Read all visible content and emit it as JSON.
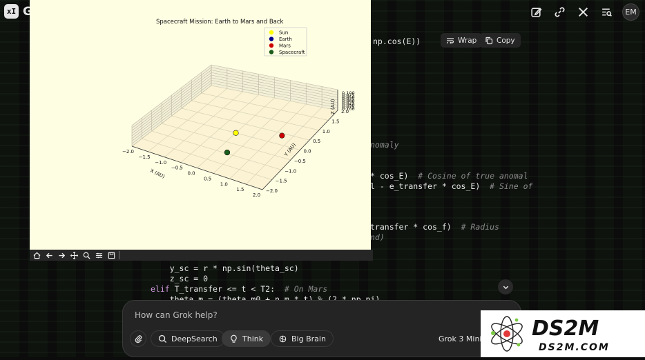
{
  "app": {
    "logo_glyph": "xI",
    "title_fragment": "G"
  },
  "header": {
    "icons": [
      "edit-icon",
      "link-icon",
      "x-logo-icon",
      "search-list-icon"
    ],
    "avatar_initials": "EM"
  },
  "code_block": {
    "wrap_label": "Wrap",
    "copy_label": "Copy",
    "lines": [
      {
        "text": "np.cos(E))",
        "comment": ""
      },
      {
        "text": "",
        "comment": "nomaly"
      },
      {
        "text": "* cos_E)",
        "comment": "# Cosine of true anomal"
      },
      {
        "text": "l - e_transfer * cos_E)",
        "comment": "# Sine of"
      },
      {
        "text": "transfer * cos_f)",
        "comment": "# Radius"
      },
      {
        "text": "",
        "comment": "nd)"
      },
      {
        "text": "    y_sc = r * np.sin(theta_sc)",
        "comment": ""
      },
      {
        "text": "    z_sc = 0",
        "comment": ""
      },
      {
        "keyword": "elif",
        "text": " T_transfer <= t < T2:",
        "comment": "# On Mars"
      },
      {
        "text": "    theta_m = (theta_m0 + n_m * t) % (2 * np.pi)",
        "comment": ""
      }
    ]
  },
  "plot_window": {
    "toolbar_icons": [
      "home-icon",
      "back-arrow-icon",
      "forward-arrow-icon",
      "pan-icon",
      "zoom-icon",
      "configure-icon",
      "save-icon"
    ]
  },
  "chart_data": {
    "type": "scatter",
    "projection": "3d",
    "title": "Spacecraft Mission: Earth to Mars and Back",
    "xlabel": "X (AU)",
    "ylabel": "Y (AU)",
    "zlabel": "Z (AU)",
    "x_ticks": [
      "−2.0",
      "−1.5",
      "−1.0",
      "−0.5",
      "0.0",
      "0.5",
      "1.0",
      "1.5",
      "2.0"
    ],
    "y_ticks": [
      "−2.0",
      "−1.5",
      "−1.0",
      "−0.5",
      "0.0",
      "0.5",
      "1.0",
      "1.5",
      "2.0"
    ],
    "z_ticks": [
      "0.100",
      "0.075",
      "0.050",
      "0.025",
      "0.000",
      "0.025",
      "0.050",
      "0.075",
      "0.100"
    ],
    "xlim": [
      -2,
      2
    ],
    "ylim": [
      -2,
      2
    ],
    "zlim": [
      -0.1,
      0.1
    ],
    "grid": true,
    "legend_position": "top-right",
    "series": [
      {
        "name": "Sun",
        "color": "#ffff00",
        "x": 0.0,
        "y": 0.0,
        "z": 0.0
      },
      {
        "name": "Earth",
        "color": "#00008b",
        "x": 0.3,
        "y": -0.95,
        "z": 0.0
      },
      {
        "name": "Mars",
        "color": "#cc0000",
        "x": 1.2,
        "y": 0.4,
        "z": 0.0
      },
      {
        "name": "Spacecraft",
        "color": "#1a5c1a",
        "x": 0.3,
        "y": -0.95,
        "z": 0.0
      }
    ]
  },
  "composer": {
    "placeholder": "How can Grok help?",
    "buttons": {
      "deepsearch": "DeepSearch",
      "think": "Think",
      "bigbrain": "Big Brain"
    },
    "model": "Grok 3 Mini"
  },
  "watermark": {
    "brand": "DS2M",
    "url": "DS2M.COM"
  }
}
